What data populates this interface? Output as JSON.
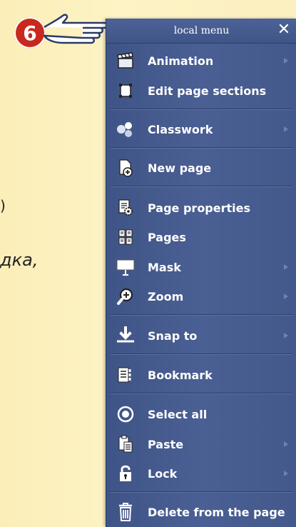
{
  "background": {
    "text_fragment": "дка,",
    "paren_fragment": ")"
  },
  "callout": {
    "badge_number": "6"
  },
  "menu": {
    "title": "local menu",
    "close_glyph": "✕",
    "items": [
      {
        "label": "Animation",
        "icon": "clapperboard-icon",
        "has_submenu": true
      },
      {
        "label": "Edit page sections",
        "icon": "section-frame-icon",
        "has_submenu": false
      },
      {
        "label": "Classwork",
        "icon": "molecule-icon",
        "has_submenu": true
      },
      {
        "label": "New page",
        "icon": "new-page-icon",
        "has_submenu": false
      },
      {
        "label": "Page properties",
        "icon": "page-gear-icon",
        "has_submenu": false
      },
      {
        "label": "Pages",
        "icon": "pages-grid-icon",
        "has_submenu": false
      },
      {
        "label": "Mask",
        "icon": "mask-screen-icon",
        "has_submenu": true
      },
      {
        "label": "Zoom",
        "icon": "zoom-icon",
        "has_submenu": true
      },
      {
        "label": "Snap to",
        "icon": "snap-down-icon",
        "has_submenu": true
      },
      {
        "label": "Bookmark",
        "icon": "bookmark-icon",
        "has_submenu": false
      },
      {
        "label": "Select all",
        "icon": "select-all-radio-icon",
        "has_submenu": false
      },
      {
        "label": "Paste",
        "icon": "paste-icon",
        "has_submenu": true
      },
      {
        "label": "Lock",
        "icon": "lock-icon",
        "has_submenu": true
      },
      {
        "label": "Delete from the page",
        "icon": "trash-icon",
        "has_submenu": false
      }
    ]
  },
  "colors": {
    "menu_bg": "#455a8d",
    "badge": "#c9281f",
    "page_bg": "#fdf3c4"
  }
}
